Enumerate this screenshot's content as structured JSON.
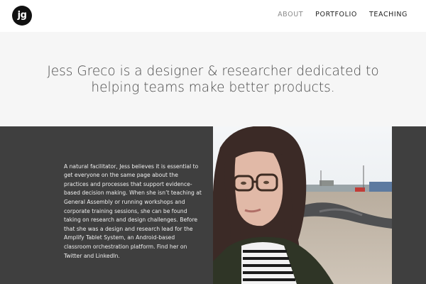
{
  "header": {
    "logo_text": "jg",
    "nav": [
      {
        "label": "ABOUT"
      },
      {
        "label": "PORTFOLIO"
      },
      {
        "label": "TEACHING"
      }
    ]
  },
  "hero": {
    "line1": "Jess Greco is a designer & researcher dedicated to",
    "line2": "helping teams make better products."
  },
  "about": {
    "bio": "A natural facilitator, Jess believes it is essential to get everyone on the same page about the practices and processes that support evidence-based decision making. When she isn’t teaching at General Assembly or running workshops and corporate training sessions, she can be found taking on research and design challenges. Before that she was a design and research lead for the Amplify Tablet System, an Android-based classroom orchestration platform. Find her on Twitter and LinkedIn."
  },
  "colors": {
    "about_bg": "#3f3f3f",
    "hero_bg": "#f6f6f6",
    "nav_active": "#8a8a8a"
  }
}
